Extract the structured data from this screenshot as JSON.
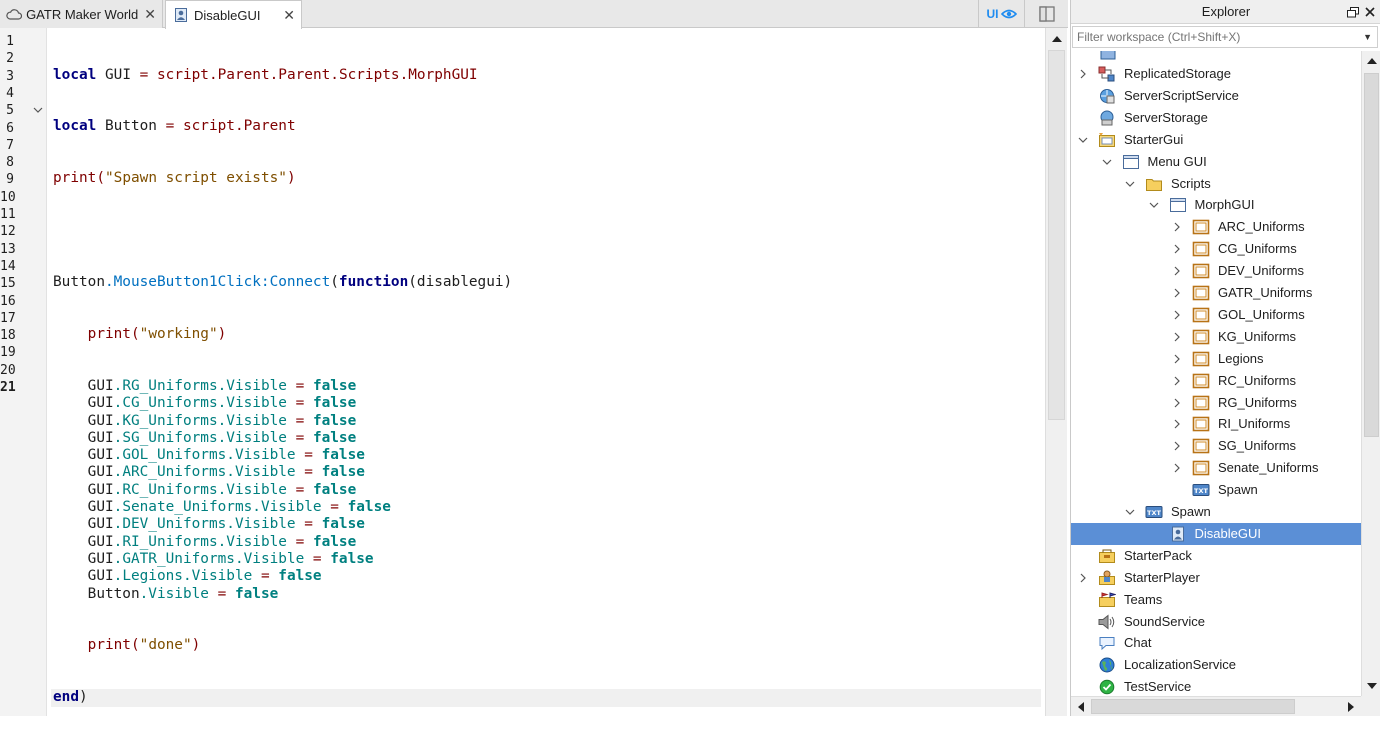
{
  "tabs": [
    {
      "label": "GATR Maker World",
      "icon": "cloud-icon",
      "close": "✕"
    },
    {
      "label": "DisableGUI",
      "icon": "local-script-icon",
      "close": "✕"
    }
  ],
  "toolbar": {
    "ui_label": "UI"
  },
  "editor": {
    "line_numbers": [
      "1",
      "2",
      "3",
      "4",
      "5",
      "6",
      "7",
      "8",
      "9",
      "10",
      "11",
      "12",
      "13",
      "14",
      "15",
      "16",
      "17",
      "18",
      "19",
      "20",
      "21"
    ],
    "current_line": "21"
  },
  "explorer": {
    "title": "Explorer",
    "filter_placeholder": "Filter workspace (Ctrl+Shift+X)",
    "items": [
      {
        "label": "ReplicatedStorage",
        "icon": "replicated-storage-icon"
      },
      {
        "label": "ServerScriptService",
        "icon": "server-script-service-icon"
      },
      {
        "label": "ServerStorage",
        "icon": "server-storage-icon"
      },
      {
        "label": "StarterGui",
        "icon": "starter-gui-icon"
      },
      {
        "label": "Menu GUI",
        "icon": "screen-gui-icon"
      },
      {
        "label": "Scripts",
        "icon": "folder-icon"
      },
      {
        "label": "MorphGUI",
        "icon": "screen-gui-icon"
      },
      {
        "label": "ARC_Uniforms",
        "icon": "frame-icon"
      },
      {
        "label": "CG_Uniforms",
        "icon": "frame-icon"
      },
      {
        "label": "DEV_Uniforms",
        "icon": "frame-icon"
      },
      {
        "label": "GATR_Uniforms",
        "icon": "frame-icon"
      },
      {
        "label": "GOL_Uniforms",
        "icon": "frame-icon"
      },
      {
        "label": "KG_Uniforms",
        "icon": "frame-icon"
      },
      {
        "label": "Legions",
        "icon": "frame-icon"
      },
      {
        "label": "RC_Uniforms",
        "icon": "frame-icon"
      },
      {
        "label": "RG_Uniforms",
        "icon": "frame-icon"
      },
      {
        "label": "RI_Uniforms",
        "icon": "frame-icon"
      },
      {
        "label": "SG_Uniforms",
        "icon": "frame-icon"
      },
      {
        "label": "Senate_Uniforms",
        "icon": "frame-icon"
      },
      {
        "label": "Spawn",
        "icon": "text-button-icon"
      },
      {
        "label": "Spawn",
        "icon": "text-button-icon"
      },
      {
        "label": "DisableGUI",
        "icon": "local-script-icon"
      },
      {
        "label": "StarterPack",
        "icon": "starter-pack-icon"
      },
      {
        "label": "StarterPlayer",
        "icon": "starter-player-icon"
      },
      {
        "label": "Teams",
        "icon": "teams-icon"
      },
      {
        "label": "SoundService",
        "icon": "sound-service-icon"
      },
      {
        "label": "Chat",
        "icon": "chat-icon"
      },
      {
        "label": "LocalizationService",
        "icon": "localization-service-icon"
      },
      {
        "label": "TestService",
        "icon": "test-service-icon"
      }
    ]
  },
  "code": {
    "l1": {
      "kw": "local",
      "a": " GUI ",
      "op": "=",
      "b": " script",
      "c": ".Parent.Parent.Scripts.MorphGUI"
    },
    "l2": {
      "kw": "local",
      "a": " Button ",
      "op": "=",
      "b": " script",
      "c": ".Parent"
    },
    "l3": {
      "fn": "print",
      "p1": "(",
      "s": "\"Spawn script exists\"",
      "p2": ")"
    },
    "l5": {
      "a": "Button",
      "b": ".MouseButton1Click:Connect",
      "p1": "(",
      "kw": "function",
      "p2": "(",
      "arg": "disablegui",
      "p3": ")"
    },
    "l6": {
      "fn": "print",
      "p1": "(",
      "s": "\"working\"",
      "p2": ")"
    },
    "assign": [
      {
        "obj": "GUI",
        "path": ".RG_Uniforms.Visible",
        "op": " = ",
        "val": "false"
      },
      {
        "obj": "GUI",
        "path": ".CG_Uniforms.Visible",
        "op": " = ",
        "val": "false"
      },
      {
        "obj": "GUI",
        "path": ".KG_Uniforms.Visible",
        "op": " = ",
        "val": "false"
      },
      {
        "obj": "GUI",
        "path": ".SG_Uniforms.Visible",
        "op": " = ",
        "val": "false"
      },
      {
        "obj": "GUI",
        "path": ".GOL_Uniforms.Visible",
        "op": " = ",
        "val": "false"
      },
      {
        "obj": "GUI",
        "path": ".ARC_Uniforms.Visible",
        "op": " = ",
        "val": "false"
      },
      {
        "obj": "GUI",
        "path": ".RC_Uniforms.Visible",
        "op": " = ",
        "val": "false"
      },
      {
        "obj": "GUI",
        "path": ".Senate_Uniforms.Visible",
        "op": " = ",
        "val": "false"
      },
      {
        "obj": "GUI",
        "path": ".DEV_Uniforms.Visible",
        "op": " = ",
        "val": "false"
      },
      {
        "obj": "GUI",
        "path": ".RI_Uniforms.Visible",
        "op": " = ",
        "val": "false"
      },
      {
        "obj": "GUI",
        "path": ".GATR_Uniforms.Visible",
        "op": " = ",
        "val": "false"
      },
      {
        "obj": "GUI",
        "path": ".Legions.Visible",
        "op": " = ",
        "val": "false"
      },
      {
        "obj": "Button",
        "path": ".Visible",
        "op": " = ",
        "val": "false"
      }
    ],
    "l20": {
      "fn": "print",
      "p1": "(",
      "s": "\"done\"",
      "p2": ")"
    },
    "l21": {
      "kw": "end",
      "p": ")"
    }
  }
}
